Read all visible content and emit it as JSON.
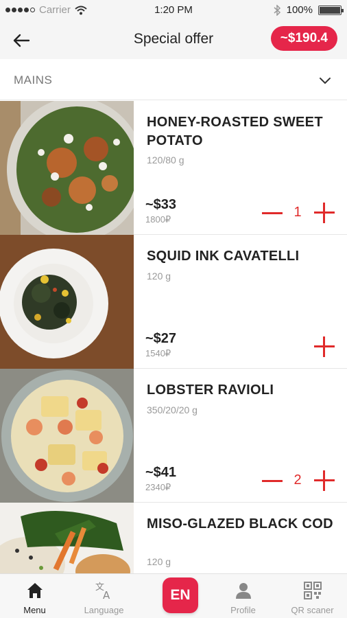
{
  "status_bar": {
    "carrier": "Carrier",
    "time": "1:20 PM",
    "battery": "100%"
  },
  "header": {
    "title": "Special offer",
    "total": "~$190.4"
  },
  "category": {
    "label": "MAINS"
  },
  "items": [
    {
      "name": "HONEY-ROASTED SWEET POTATO",
      "weight": "120/80 g",
      "price": "~$33",
      "local_price": "1800₽",
      "quantity": "1"
    },
    {
      "name": "SQUID INK CAVATELLI",
      "weight": "120 g",
      "price": "~$27",
      "local_price": "1540₽",
      "quantity": ""
    },
    {
      "name": "LOBSTER RAVIOLI",
      "weight": "350/20/20 g",
      "price": "~$41",
      "local_price": "2340₽",
      "quantity": "2"
    },
    {
      "name": "MISO-GLAZED BLACK COD",
      "weight": "120 g",
      "price": "",
      "local_price": "",
      "quantity": ""
    }
  ],
  "tabs": {
    "menu": "Menu",
    "language": "Language",
    "language_code": "EN",
    "profile": "Profile",
    "qr": "QR scaner"
  },
  "colors": {
    "accent": "#e5264a",
    "qty_control": "#e02a2a",
    "muted_text": "#999999"
  }
}
